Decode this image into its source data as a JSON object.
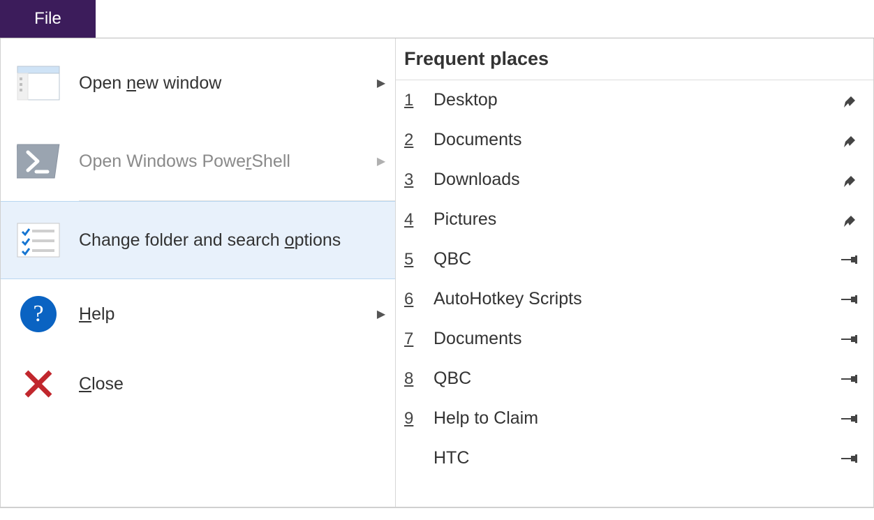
{
  "tabs": {
    "file": "File"
  },
  "menu": {
    "open_new_window": {
      "pre": "Open ",
      "hot": "n",
      "post": "ew window"
    },
    "powershell": {
      "pre": "Open Windows Powe",
      "hot": "r",
      "post": "Shell"
    },
    "options": {
      "pre": "Change folder and search ",
      "hot": "o",
      "post": "ptions"
    },
    "help": {
      "pre": "",
      "hot": "H",
      "post": "elp"
    },
    "close": {
      "pre": "",
      "hot": "C",
      "post": "lose"
    }
  },
  "section_title": "Frequent places",
  "places": [
    {
      "num": "1",
      "name": "Desktop",
      "pinned": true
    },
    {
      "num": "2",
      "name": "Documents",
      "pinned": true
    },
    {
      "num": "3",
      "name": "Downloads",
      "pinned": true
    },
    {
      "num": "4",
      "name": "Pictures",
      "pinned": true
    },
    {
      "num": "5",
      "name": "QBC",
      "pinned": false
    },
    {
      "num": "6",
      "name": "AutoHotkey Scripts",
      "pinned": false
    },
    {
      "num": "7",
      "name": "Documents",
      "pinned": false
    },
    {
      "num": "8",
      "name": "QBC",
      "pinned": false
    },
    {
      "num": "9",
      "name": "Help to Claim",
      "pinned": false
    },
    {
      "num": "",
      "name": "HTC",
      "pinned": false
    }
  ]
}
